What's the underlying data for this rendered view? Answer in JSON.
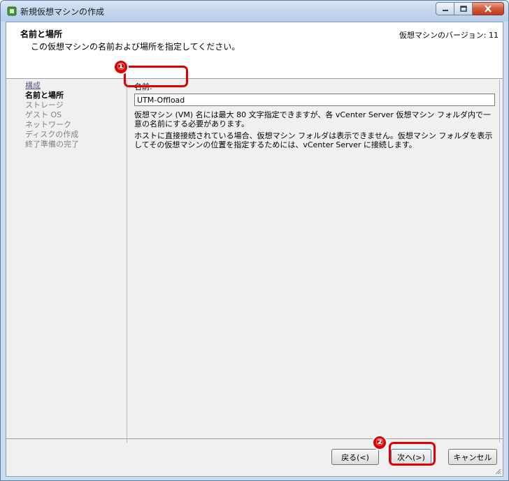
{
  "window": {
    "title": "新規仮想マシンの作成"
  },
  "header": {
    "title": "名前と場所",
    "description": "この仮想マシンの名前および場所を指定してください。",
    "version": "仮想マシンのバージョン: 11"
  },
  "steps": [
    {
      "label": "構成",
      "state": "link"
    },
    {
      "label": "名前と場所",
      "state": "current"
    },
    {
      "label": "ストレージ",
      "state": "disabled"
    },
    {
      "label": "ゲスト OS",
      "state": "disabled"
    },
    {
      "label": "ネットワーク",
      "state": "disabled"
    },
    {
      "label": "ディスクの作成",
      "state": "disabled"
    },
    {
      "label": "終了準備の完了",
      "state": "disabled"
    }
  ],
  "form": {
    "name_label": "名前:",
    "name_value": "UTM-Offload",
    "help1": "仮想マシン (VM) 名には最大 80 文字指定できますが、各 vCenter Server 仮想マシン フォルダ内で一意の名前にする必要があります。",
    "help2": "ホストに直接接続されている場合、仮想マシン フォルダは表示できません。仮想マシン フォルダを表示してその仮想マシンの位置を指定するためには、vCenter Server に接続します。"
  },
  "annotations": {
    "marker1": "①",
    "marker2": "②",
    "highlight_color": "#e00000"
  },
  "buttons": {
    "back": "戻る(<)",
    "next": "次へ(>)",
    "cancel": "キャンセル"
  }
}
